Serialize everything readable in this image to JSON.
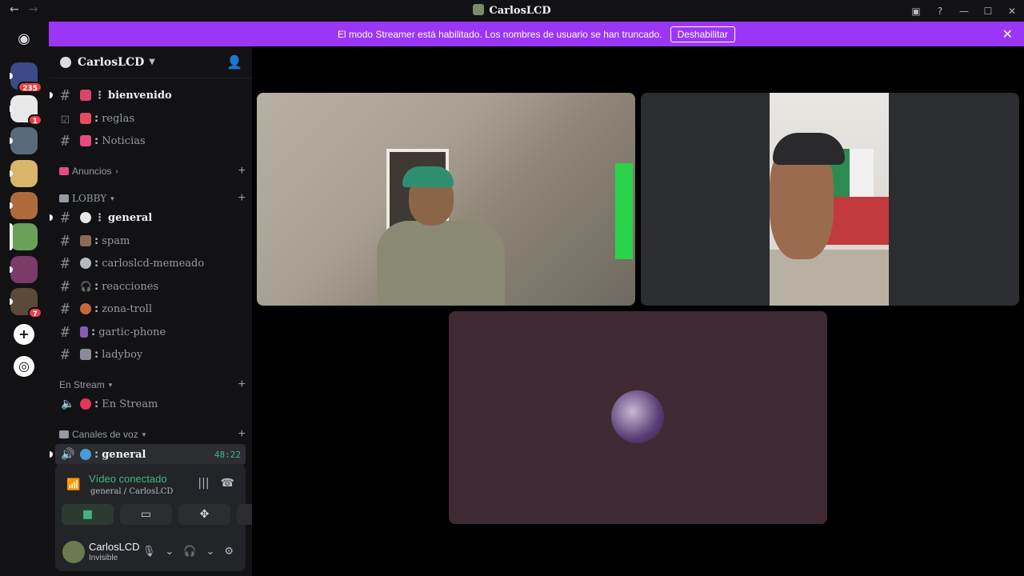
{
  "titlebar": {
    "title": "CarlosLCD",
    "back_icon": "arrow-left-icon",
    "forward_icon": "arrow-right-icon",
    "controls": [
      "inbox-icon",
      "help-icon",
      "minimize-icon",
      "maximize-icon",
      "close-icon"
    ]
  },
  "rail": {
    "servers": [
      {
        "name": "server-1",
        "badge": "235",
        "color": "#3a4a8a"
      },
      {
        "name": "server-2",
        "badge": "1",
        "color": "#e8e8e8"
      },
      {
        "name": "server-3",
        "badge": "",
        "color": "#5a6a7a"
      },
      {
        "name": "server-4",
        "badge": "",
        "color": "#d9b56a"
      },
      {
        "name": "server-5",
        "badge": "",
        "color": "#b06a3a"
      },
      {
        "name": "server-6",
        "badge": "",
        "color": "#6aa05a"
      },
      {
        "name": "server-7",
        "badge": "",
        "color": "#7a3a6a"
      },
      {
        "name": "server-8",
        "badge": "7",
        "color": "#5a4a3a"
      }
    ]
  },
  "banner": {
    "message": "El modo Streamer está habilitado. Los nombres de usuario se han truncado.",
    "button": "Deshabilitar"
  },
  "guild": {
    "name": "CarlosLCD"
  },
  "channels_top": [
    {
      "label": "bienvenido",
      "emoji_color": "#d9466b",
      "unread": true
    },
    {
      "label": "reglas",
      "emoji_color": "#e84a5f",
      "unread": false
    },
    {
      "label": "Noticias",
      "emoji_color": "#e84a7f",
      "unread": false
    }
  ],
  "categories": {
    "anuncios": "Anuncios",
    "lobby": "LOBBY",
    "en_stream": "En Stream",
    "voz": "Canales de voz"
  },
  "channels_lobby": [
    {
      "label": "general",
      "emoji_color": "#e8e8e8",
      "unread": true
    },
    {
      "label": "spam",
      "emoji_color": "#8a6a5a",
      "unread": false
    },
    {
      "label": "carloslcd-memeado",
      "emoji_color": "#b5bac1",
      "unread": false
    },
    {
      "label": "reacciones",
      "emoji_color": "#b5bac1",
      "unread": false
    },
    {
      "label": "zona-troll",
      "emoji_color": "#c8683a",
      "unread": false
    },
    {
      "label": "gartic-phone",
      "emoji_color": "#8a5ab0",
      "unread": false
    },
    {
      "label": "ladyboy",
      "emoji_color": "#8a8a9a",
      "unread": false
    }
  ],
  "channel_stream": {
    "label": "En Stream",
    "emoji_color": "#e8345a"
  },
  "channel_voice": {
    "label": "general",
    "emoji_color": "#4a9ad8",
    "timer": "48:22"
  },
  "voice_panel": {
    "status": "Vídeo conectado",
    "sub": "general / CarlosLCD"
  },
  "user": {
    "name": "CarlosLCD",
    "state": "Invisible"
  }
}
